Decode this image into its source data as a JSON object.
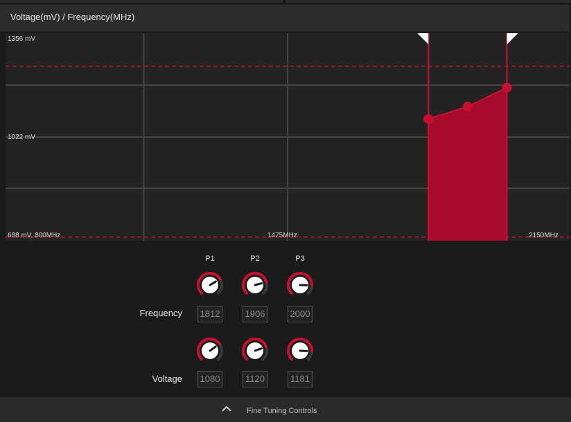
{
  "header": {
    "title": "Voltage(mV) / Frequency(MHz)"
  },
  "chart_data": {
    "type": "area",
    "title": "Voltage(mV) / Frequency(MHz)",
    "x_labels": {
      "min": "688 mV, 800MHz",
      "mid": "1475MHz",
      "max": "2150MHz"
    },
    "y_labels": {
      "top": "1356 mV",
      "mid": "1022 mV"
    },
    "xlim": [
      800,
      2150
    ],
    "ylim": [
      688,
      1356
    ],
    "series": [
      {
        "x": [
          1812,
          1906,
          2000
        ],
        "y": [
          1080,
          1120,
          1181
        ]
      }
    ],
    "reference_lines_mv": [
      1250,
      700
    ],
    "accent": "#c8102e",
    "fill": "#a80a2c",
    "grid": true
  },
  "controls": {
    "columns": [
      "P1",
      "P2",
      "P3"
    ],
    "frequency": {
      "label": "Frequency",
      "values": [
        "1812",
        "1906",
        "2000"
      ],
      "knob_levels": [
        0.72,
        0.78,
        0.84
      ]
    },
    "voltage": {
      "label": "Voltage",
      "values": [
        "1080",
        "1120",
        "1181"
      ],
      "knob_levels": [
        0.7,
        0.76,
        0.84
      ]
    }
  },
  "footer": {
    "label": "Fine Tuning Controls",
    "icon": "chevron-up-icon"
  }
}
